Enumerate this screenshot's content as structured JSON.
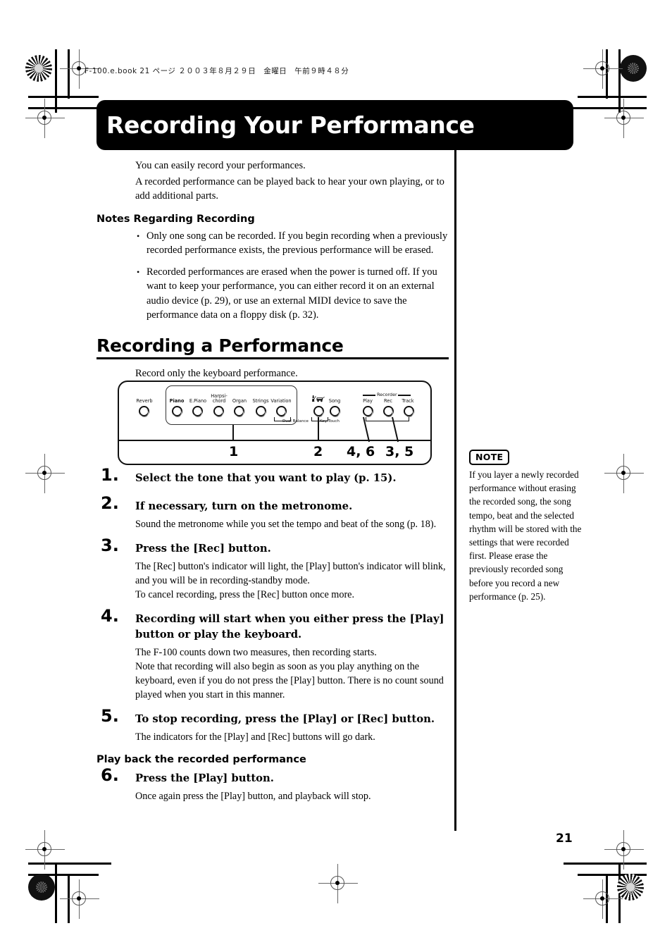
{
  "header": {
    "file_line": "F-100.e.book  21 ページ  ２００３年８月２９日　金曜日　午前９時４８分"
  },
  "title": {
    "banner": "Recording Your Performance"
  },
  "intro": {
    "line1": "You can easily record your performances.",
    "line2": "A recorded performance can be played back to hear your own playing, or to add additional parts."
  },
  "notes_section": {
    "heading": "Notes Regarding Recording",
    "bullets": [
      "Only one song can be recorded. If you begin recording when a previously recorded performance exists, the previous performance will be erased.",
      "Recorded performances are erased when the power is turned off. If you want to keep your performance, you can either record it on an external audio device (p. 29), or use an external MIDI device to save the performance data on a floppy disk (p. 32)."
    ]
  },
  "section": {
    "heading": "Recording a Performance",
    "intro": "Record only the keyboard performance."
  },
  "panel": {
    "labels": {
      "reverb": "Reverb",
      "piano": "Piano",
      "epiano": "E.Piano",
      "harpsichord_line1": "Harpsi-",
      "harpsichord_line2": "chord",
      "organ": "Organ",
      "strings": "Strings",
      "variation": "Variation",
      "song": "Song",
      "recorder": "Recorder",
      "play": "Play",
      "rec": "Rec",
      "track": "Track",
      "dual_balance": "Dual Balance",
      "key_touch": "Key Touch"
    },
    "callouts": {
      "tone": "1",
      "metronome": "2",
      "play": "4, 6",
      "rec": "3, 5"
    }
  },
  "steps": [
    {
      "num": "1.",
      "title": "Select the tone that you want to play (p. 15).",
      "body": ""
    },
    {
      "num": "2.",
      "title": "If necessary, turn on the metronome.",
      "body": "Sound the metronome while you set the tempo and beat of the song (p. 18)."
    },
    {
      "num": "3.",
      "title": "Press the [Rec] button.",
      "body": "The [Rec] button's indicator will light, the [Play] button's indicator will blink, and you will be in recording-standby mode.\nTo cancel recording, press the [Rec] button once more."
    },
    {
      "num": "4.",
      "title": "Recording will start when you either press the [Play] button or play the keyboard.",
      "body": "The F-100 counts down two measures, then recording starts.\nNote that recording will also begin as soon as you play anything on the keyboard, even if you do not press the [Play] button. There is no count sound played when you start in this manner."
    },
    {
      "num": "5.",
      "title": "To stop recording, press the [Play] or [Rec] button.",
      "body": "The indicators for the [Play] and [Rec] buttons will go dark."
    },
    {
      "num": "6.",
      "title": "Press the [Play] button.",
      "body": "Once again press the [Play] button, and playback will stop."
    }
  ],
  "playback_heading": "Play back the recorded performance",
  "note": {
    "badge": "NOTE",
    "text": "If you layer a newly recorded performance without erasing the recorded song, the song tempo, beat and the selected rhythm will be stored with the settings that were recorded first. Please erase the previously recorded song before you record a new performance (p. 25)."
  },
  "page_number": "21"
}
